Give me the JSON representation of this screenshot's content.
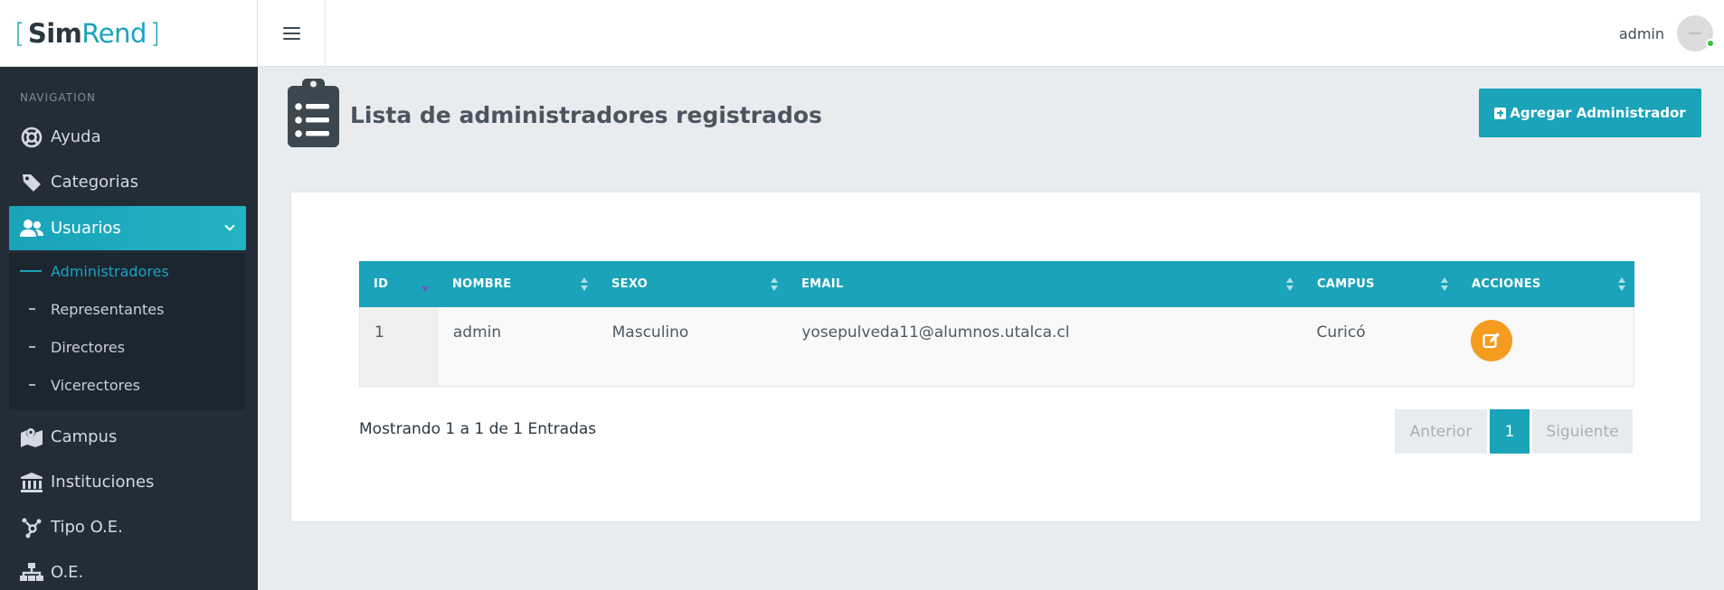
{
  "brand": {
    "open": "[",
    "sim": "Sim",
    "rend": "Rend",
    "close": "]"
  },
  "topbar": {
    "user_name": "admin"
  },
  "sidebar": {
    "heading": "NAVIGATION",
    "items": [
      {
        "label": "Ayuda",
        "icon": "lifebuoy-icon"
      },
      {
        "label": "Categorias",
        "icon": "tag-icon"
      },
      {
        "label": "Usuarios",
        "icon": "users-icon",
        "active": true
      },
      {
        "label": "Campus",
        "icon": "map-marker-icon"
      },
      {
        "label": "Instituciones",
        "icon": "university-icon"
      },
      {
        "label": "Tipo O.E.",
        "icon": "hub-icon"
      },
      {
        "label": "O.E.",
        "icon": "sitemap-icon"
      }
    ],
    "submenu": [
      {
        "label": "Administradores",
        "active": true
      },
      {
        "label": "Representantes"
      },
      {
        "label": "Directores"
      },
      {
        "label": "Vicerectores"
      }
    ]
  },
  "page": {
    "title": "Lista de administradores registrados",
    "add_button": "Agregar Administrador"
  },
  "table": {
    "columns": [
      "ID",
      "NOMBRE",
      "SEXO",
      "EMAIL",
      "CAMPUS",
      "ACCIONES"
    ],
    "rows": [
      {
        "id": "1",
        "nombre": "admin",
        "sexo": "Masculino",
        "email": "yosepulveda11@alumnos.utalca.cl",
        "campus": "Curicó"
      }
    ],
    "info": "Mostrando 1 a 1 de 1 Entradas"
  },
  "pagination": {
    "prev": "Anterior",
    "current": "1",
    "next": "Siguiente"
  },
  "colors": {
    "accent": "#1aa3b9",
    "sidebar_bg": "#222d38",
    "edit_button": "#f39c1f"
  }
}
